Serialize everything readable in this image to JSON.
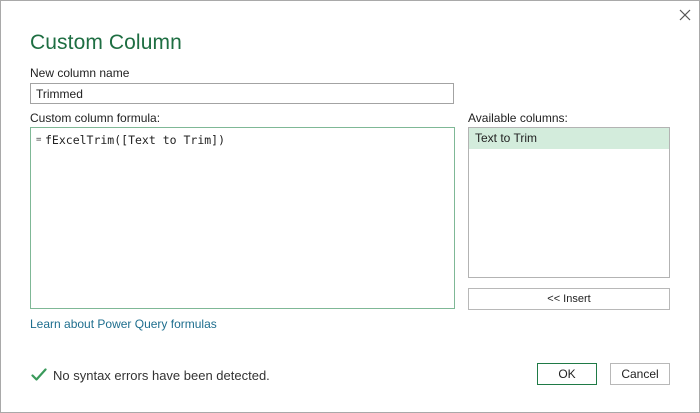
{
  "dialog": {
    "title": "Custom Column",
    "new_column_label": "New column name",
    "new_column_value": "Trimmed",
    "formula_label": "Custom column formula:",
    "formula_prefix": "=",
    "formula_value": "fExcelTrim([Text to Trim])",
    "available_columns_label": "Available columns:",
    "available_columns": [
      "Text to Trim"
    ],
    "insert_label": "<< Insert",
    "learn_link": "Learn about Power Query formulas",
    "status_text": "No syntax errors have been detected.",
    "ok_label": "OK",
    "cancel_label": "Cancel"
  },
  "icons": {
    "close": "close-icon",
    "status": "checkmark-icon"
  },
  "colors": {
    "title": "#1e6e42",
    "accent_green": "#1f7a46",
    "selection": "#d3ecdc",
    "link": "#1e6e8e",
    "checkmark": "#3a9a5b"
  }
}
